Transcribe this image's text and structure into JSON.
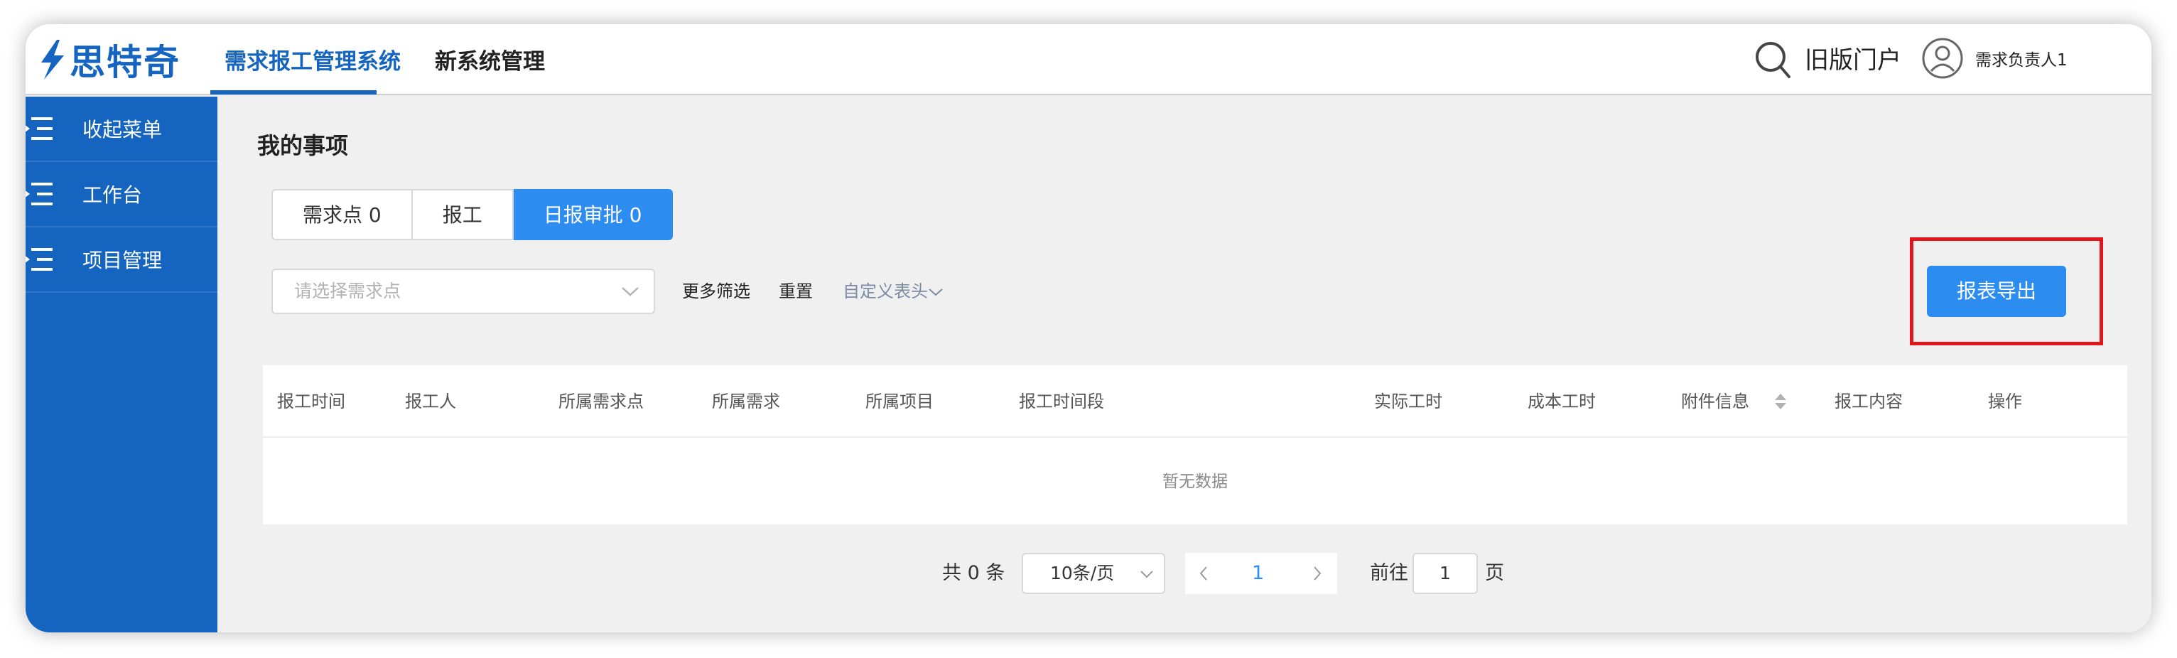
{
  "brand": {
    "name": "思特奇",
    "color": "#1565c0"
  },
  "header": {
    "tabs": [
      {
        "label": "需求报工管理系统",
        "active": true
      },
      {
        "label": "新系统管理",
        "active": false
      }
    ],
    "old_portal": "旧版门户",
    "user_name": "需求负责人1"
  },
  "sidebar": {
    "items": [
      {
        "label": "收起菜单",
        "icon": "menu-icon"
      },
      {
        "label": "工作台",
        "icon": "menu-icon"
      },
      {
        "label": "项目管理",
        "icon": "menu-icon"
      }
    ]
  },
  "main": {
    "title": "我的事项",
    "tabs": [
      {
        "label": "需求点 0",
        "active": false
      },
      {
        "label": "报工",
        "active": false
      },
      {
        "label": "日报审批 0",
        "active": true
      }
    ],
    "filters": {
      "select_placeholder": "请选择需求点",
      "more_filters": "更多筛选",
      "reset": "重置",
      "custom_header": "自定义表头"
    },
    "export_button": "报表导出",
    "table": {
      "columns": [
        "报工时间",
        "报工人",
        "所属需求点",
        "所属需求",
        "所属项目",
        "报工时间段",
        "实际工时",
        "成本工时",
        "附件信息",
        "报工内容",
        "操作"
      ],
      "empty_text": "暂无数据"
    },
    "pagination": {
      "total": "共 0 条",
      "page_size": "10条/页",
      "current_page": "1",
      "goto_label": "前往",
      "goto_value": "1",
      "goto_suffix": "页"
    }
  },
  "colors": {
    "primary": "#2d8cf0",
    "sidebar": "#1565c0",
    "highlight": "#e0161c"
  }
}
